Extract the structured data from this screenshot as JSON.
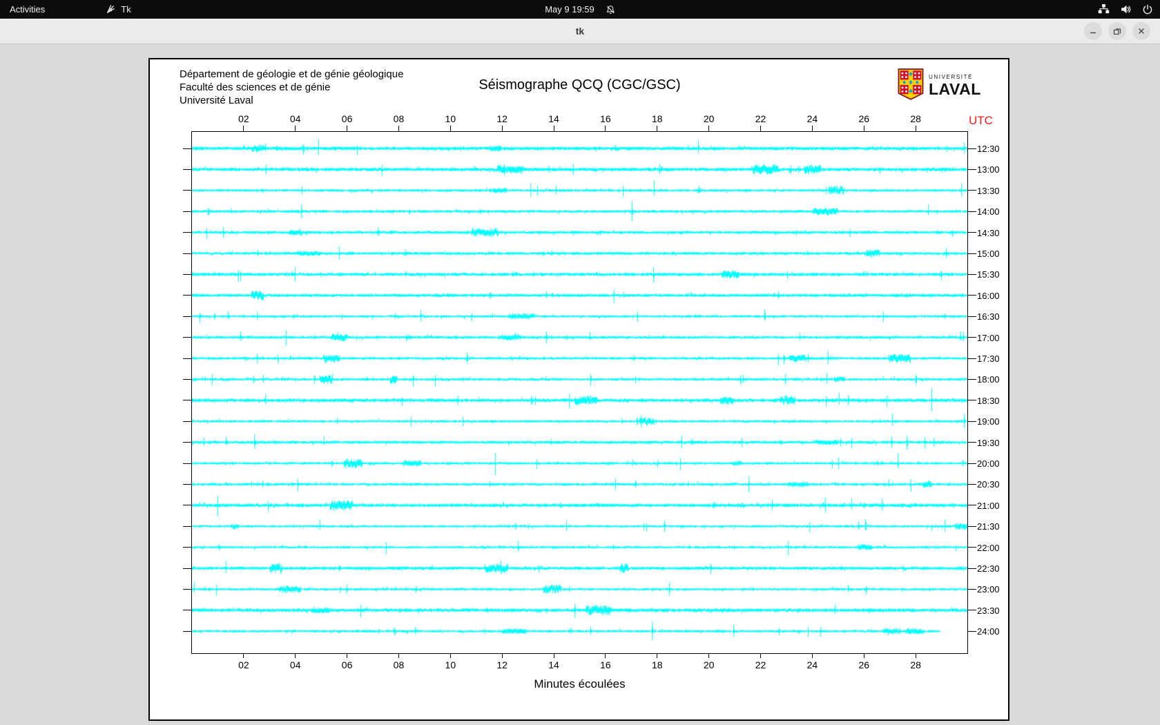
{
  "topbar": {
    "activities_label": "Activities",
    "app_menu_label": "Tk",
    "clock": "May 9 19:59",
    "icons": [
      "tk-icon",
      "notifications-muted-icon",
      "network-wired-icon",
      "volume-icon",
      "power-icon"
    ]
  },
  "titlebar": {
    "title": "tk",
    "controls": [
      "minimize",
      "restore",
      "close"
    ]
  },
  "panel": {
    "header_lines": [
      "Département de géologie et de génie géologique",
      "Faculté des sciences et de génie",
      "Université Laval"
    ],
    "logo": {
      "line1": "UNIVERSITÉ",
      "line2": "LAVAL"
    }
  },
  "chart_data": {
    "type": "line",
    "title": "Séismographe QCQ (CGC/GSC)",
    "xlabel": "Minutes écoulées",
    "y_axis_label": "UTC",
    "x_range_minutes": [
      0,
      30
    ],
    "x_tick_minutes": [
      2,
      4,
      6,
      8,
      10,
      12,
      14,
      16,
      18,
      20,
      22,
      24,
      26,
      28
    ],
    "x_tick_labels": [
      "02",
      "04",
      "06",
      "08",
      "10",
      "12",
      "14",
      "16",
      "18",
      "20",
      "22",
      "24",
      "26",
      "28"
    ],
    "trace_labels": [
      "12:30",
      "13:00",
      "13:30",
      "14:00",
      "14:30",
      "15:00",
      "15:30",
      "16:00",
      "16:30",
      "17:00",
      "17:30",
      "18:00",
      "18:30",
      "19:00",
      "19:30",
      "20:00",
      "20:30",
      "21:00",
      "21:30",
      "22:00",
      "22:30",
      "23:00",
      "23:30",
      "24:00"
    ],
    "minutes_per_row": 30,
    "last_row_end_fraction": 0.965,
    "trace_color": "#00ffff",
    "axis_color": "#000000",
    "utc_label_color": "#fb1717",
    "grid": false,
    "appearance": {
      "seed": 20240509,
      "noise_base": 1.7,
      "spike_amp_range": [
        4,
        13
      ],
      "spike_count_range": [
        6,
        15
      ],
      "burst_count_range": [
        1,
        3
      ]
    }
  },
  "colors": {
    "topbar_bg": "#0c0c0c",
    "titlebar_bg": "#ebebeb",
    "window_bg": "#d9d9d9",
    "panel_bg": "#ffffff",
    "logo_red": "#d11030",
    "logo_gold": "#ffcf01",
    "logo_blue": "#1d9fde"
  }
}
